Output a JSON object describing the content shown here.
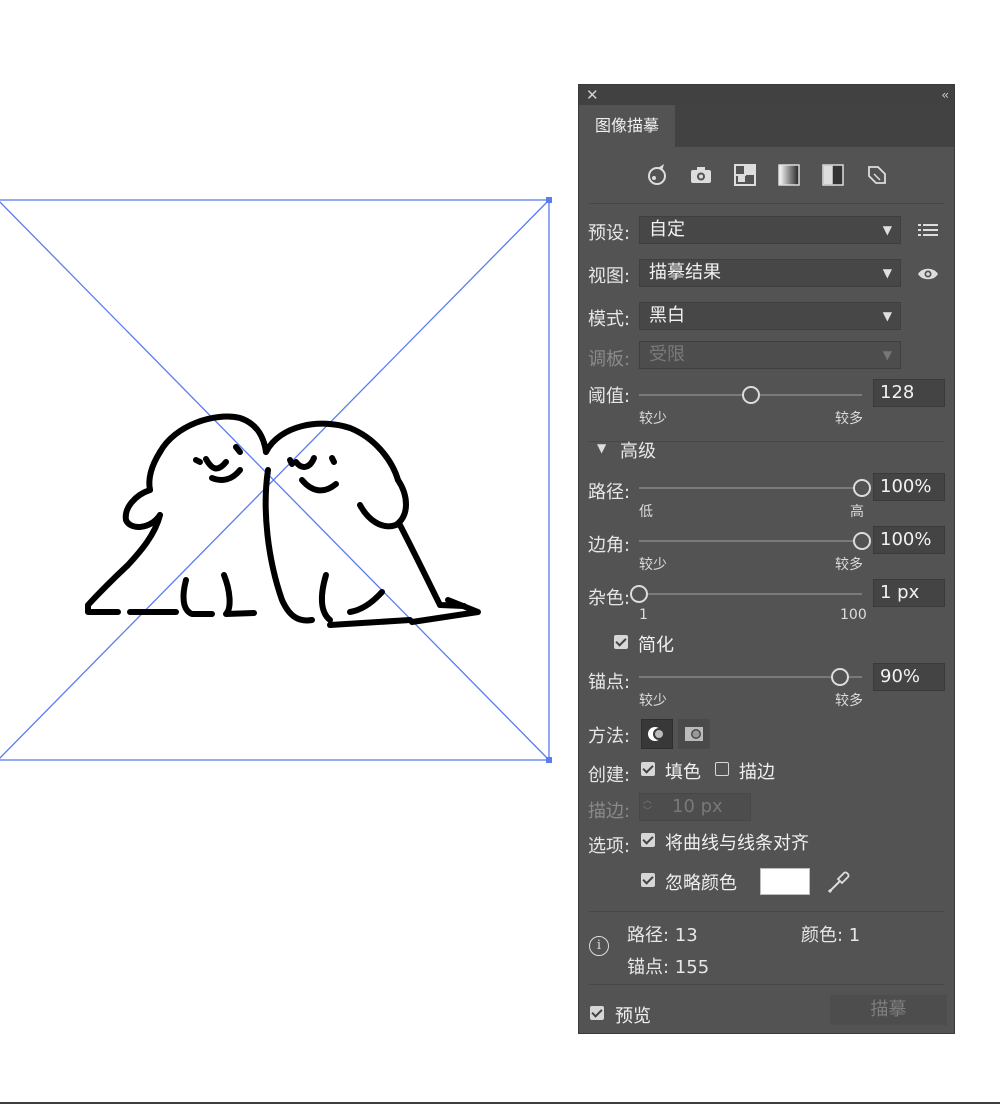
{
  "panel": {
    "tab_label": "图像描摹",
    "close_glyph": "✕",
    "collapse_glyph": "‹‹",
    "toolbar_icons": [
      "auto-color-icon",
      "high-color-icon",
      "low-color-icon",
      "grayscale-icon",
      "black-white-icon",
      "outline-icon"
    ],
    "preset": {
      "label": "预设:",
      "value": "自定"
    },
    "view": {
      "label": "视图:",
      "value": "描摹结果"
    },
    "mode": {
      "label": "模式:",
      "value": "黑白"
    },
    "palette": {
      "label": "调板:",
      "value": "受限"
    },
    "threshold": {
      "label": "阈值:",
      "value": "128",
      "level": 128,
      "max": 255,
      "min_label": "较少",
      "max_label": "较多"
    },
    "advanced_label": "高级",
    "paths": {
      "label": "路径:",
      "value": "100%",
      "level": 1.0,
      "min_label": "低",
      "max_label": "高"
    },
    "corners": {
      "label": "边角:",
      "value": "100%",
      "level": 1.0,
      "min_label": "较少",
      "max_label": "较多"
    },
    "noise": {
      "label": "杂色:",
      "value": "1 px",
      "level": 0.0,
      "min_label": "1",
      "max_label": "100"
    },
    "simplify": {
      "label": "简化",
      "checked": true
    },
    "anchors": {
      "label": "锚点:",
      "value": "90%",
      "level": 0.9,
      "min_label": "较少",
      "max_label": "较多"
    },
    "method": {
      "label": "方法:"
    },
    "create": {
      "label": "创建:",
      "fill_label": "填色",
      "fill_checked": true,
      "stroke_label": "描边",
      "stroke_checked": false
    },
    "stroke": {
      "label": "描边:",
      "value": "10 px"
    },
    "options": {
      "label": "选项:",
      "snap_label": "将曲线与线条对齐",
      "ignore_label": "忽略颜色",
      "ignore_color": "#ffffff"
    },
    "info": {
      "paths": "路径: 13",
      "colors": "颜色: 1",
      "anchors": "锚点: 155"
    },
    "preview": {
      "label": "预览",
      "checked": true
    },
    "trace_button": "描摹"
  },
  "colors": {
    "panel_bg": "#535353",
    "selection_blue": "#5b7cf0",
    "artwork": "#000000"
  }
}
